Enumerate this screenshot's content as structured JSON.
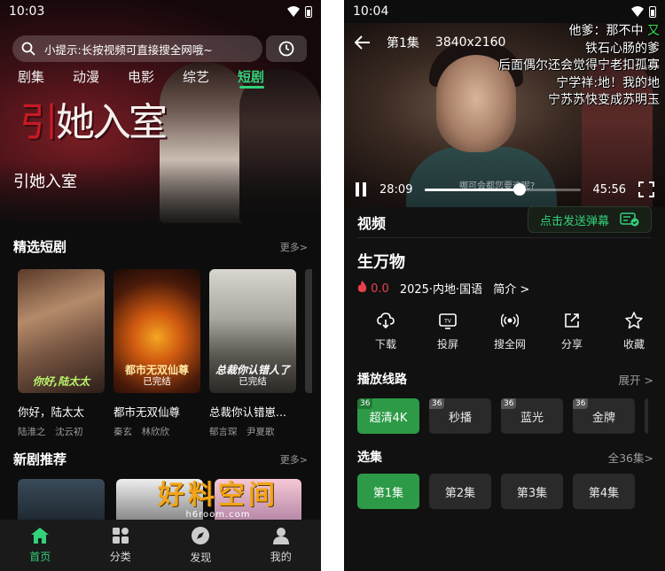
{
  "left": {
    "status": {
      "time": "10:03"
    },
    "search": {
      "placeholder": "小提示:长按视频可直接搜全网哦~"
    },
    "categories": [
      "剧集",
      "动漫",
      "电影",
      "综艺",
      "短剧"
    ],
    "active_category": "短剧",
    "hero": {
      "logo_text": "引她入室",
      "title": "引她入室"
    },
    "featured": {
      "title": "精选短剧",
      "more": "更多>",
      "items": [
        {
          "poster_text": "你好,陆太太",
          "name": "你好，陆太太",
          "cast": "陆淮之　沈云初"
        },
        {
          "poster_text": "都市无双仙尊",
          "badge": "已完结",
          "name": "都市无双仙尊",
          "cast": "秦玄　林欣欣"
        },
        {
          "poster_text": "总裁你认错人了",
          "badge": "已完结",
          "name": "总裁你认错崽...",
          "cast": "郁言琛　尹夏歌"
        }
      ]
    },
    "new_dramas": {
      "title": "新剧推荐",
      "more": "更多>"
    },
    "nav": [
      {
        "label": "首页",
        "icon": "home-icon",
        "active": true
      },
      {
        "label": "分类",
        "icon": "grid-icon",
        "active": false
      },
      {
        "label": "发现",
        "icon": "compass-icon",
        "active": false
      },
      {
        "label": "我的",
        "icon": "user-icon",
        "active": false
      }
    ]
  },
  "right": {
    "status": {
      "time": "10:04"
    },
    "player": {
      "episode": "第1集",
      "resolution": "3840x2160",
      "current_time": "28:09",
      "total_time": "45:56",
      "progress": 0.61,
      "subtitle": "哪可会都您要这呢?",
      "danmaku": [
        "他爹：那不中",
        "铁石心肠的爹",
        "后面偶尔还会觉得宁老扣孤寡",
        "宁学祥:地！我的地",
        "宁苏苏快变成苏明玉"
      ],
      "danmaku_green": "又"
    },
    "tab_video": "视频",
    "danmu_button": "点击发送弹幕",
    "show": {
      "title": "生万物",
      "heat": "0.0",
      "info": "2025·内地·国语",
      "intro": "简介 >"
    },
    "actions": [
      {
        "label": "下载",
        "icon": "download-icon"
      },
      {
        "label": "投屏",
        "icon": "cast-tv-icon"
      },
      {
        "label": "搜全网",
        "icon": "broadcast-icon"
      },
      {
        "label": "分享",
        "icon": "share-icon"
      },
      {
        "label": "收藏",
        "icon": "star-icon"
      }
    ],
    "lines": {
      "title": "播放线路",
      "more": "展开 >",
      "items": [
        {
          "label": "超清4K",
          "tag": "36",
          "active": true
        },
        {
          "label": "秒播",
          "tag": "36",
          "active": false
        },
        {
          "label": "蓝光",
          "tag": "36",
          "active": false
        },
        {
          "label": "金牌",
          "tag": "36",
          "active": false
        }
      ]
    },
    "episodes": {
      "title": "选集",
      "more": "全36集>",
      "items": [
        "第1集",
        "第2集",
        "第3集",
        "第4集"
      ]
    },
    "watermark": {
      "main": "好料空间",
      "url": "h6room.com"
    }
  },
  "colors": {
    "accent_green": "#33d17a",
    "chip_active": "#2c9a46",
    "heat_red": "#e8404b",
    "watermark_gold": "#f2a51a"
  }
}
